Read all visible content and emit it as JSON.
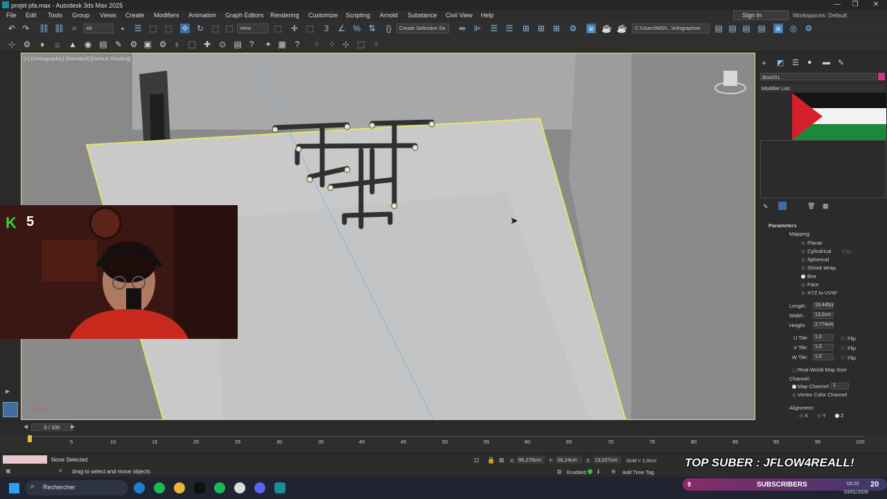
{
  "window": {
    "title": "projet pfa.max - Autodesk 3ds Max 2025"
  },
  "menu": [
    "File",
    "Edit",
    "Tools",
    "Group",
    "Views",
    "Create",
    "Modifiers",
    "Animation",
    "Graph Editors",
    "Rendering",
    "Customize",
    "Scripting",
    "Arnold",
    "Substance",
    "Civil View",
    "Help"
  ],
  "account": {
    "signin": "Sign In",
    "workspaces": "Workspaces: Default"
  },
  "toolbar": {
    "filter": "All",
    "view_dropdown": "View",
    "selection_set": "Create Selection Se",
    "path": "C:\\Users\\MSI\\...\\infographoe"
  },
  "viewport": {
    "label": "[+] [Orthographic] [Standard] [Default Shading]"
  },
  "webcam": {
    "badge": "K",
    "count": "5"
  },
  "command_panel": {
    "object_name": "Box001",
    "modifier_list": "Modifier List",
    "rollout": "Parameters",
    "mapping_label": "Mapping:",
    "mapping_options": [
      {
        "label": "Planar",
        "selected": false
      },
      {
        "label": "Cylindrical",
        "selected": false
      },
      {
        "label": "Spherical",
        "selected": false
      },
      {
        "label": "Shrink Wrap",
        "selected": false
      },
      {
        "label": "Box",
        "selected": true
      },
      {
        "label": "Face",
        "selected": false
      },
      {
        "label": "XYZ to UVW",
        "selected": false
      }
    ],
    "cap": "Cap",
    "length_label": "Length:",
    "length": "19,445cr",
    "width_label": "Width:",
    "width": "13,2cm",
    "height_label": "Height:",
    "height": "2,774cm",
    "utile_label": "U Tile:",
    "utile": "1,0",
    "vtile_label": "V Tile:",
    "vtile": "1,0",
    "wtile_label": "W Tile:",
    "wtile": "1,0",
    "flip": "Flip",
    "real_world": "Real-World Map Size",
    "channel_label": "Channel:",
    "map_channel": "Map Channel:",
    "map_channel_value": "1",
    "vertex_color": "Vertex Color Channel",
    "alignment_label": "Alignment:",
    "align_x": "X",
    "align_y": "Y",
    "align_z": "Z"
  },
  "timeline": {
    "frames": "0 / 100",
    "ticks": [
      "5",
      "10",
      "15",
      "20",
      "25",
      "30",
      "35",
      "40",
      "45",
      "50",
      "55",
      "60",
      "65",
      "70",
      "75",
      "80",
      "85",
      "90",
      "95",
      "100"
    ]
  },
  "status": {
    "selection": "None Selected",
    "prompt": "drag to select and move objects",
    "x_label": "X:",
    "x": "95,279cm",
    "y_label": "Y:",
    "y": "28,24cm",
    "z_label": "Z:",
    "z": "13,027cm",
    "grid": "Grid = 1,0cm",
    "enabled": "Enabled:",
    "add_time_tag": "Add Time Tag"
  },
  "overlay": {
    "top_suber": "TOP SUBER : JFLOW4REALL!",
    "subscribers": "SUBSCRIBERS",
    "sub_count": "9",
    "sub_right": "20"
  },
  "taskbar": {
    "search": "Rechercher",
    "time": "03:20",
    "date": "03/01/2026"
  },
  "colors": {
    "selection_outline": "#e9e26a",
    "accent_blue": "#4a90d9",
    "webcam_bg": "#3a1712"
  }
}
